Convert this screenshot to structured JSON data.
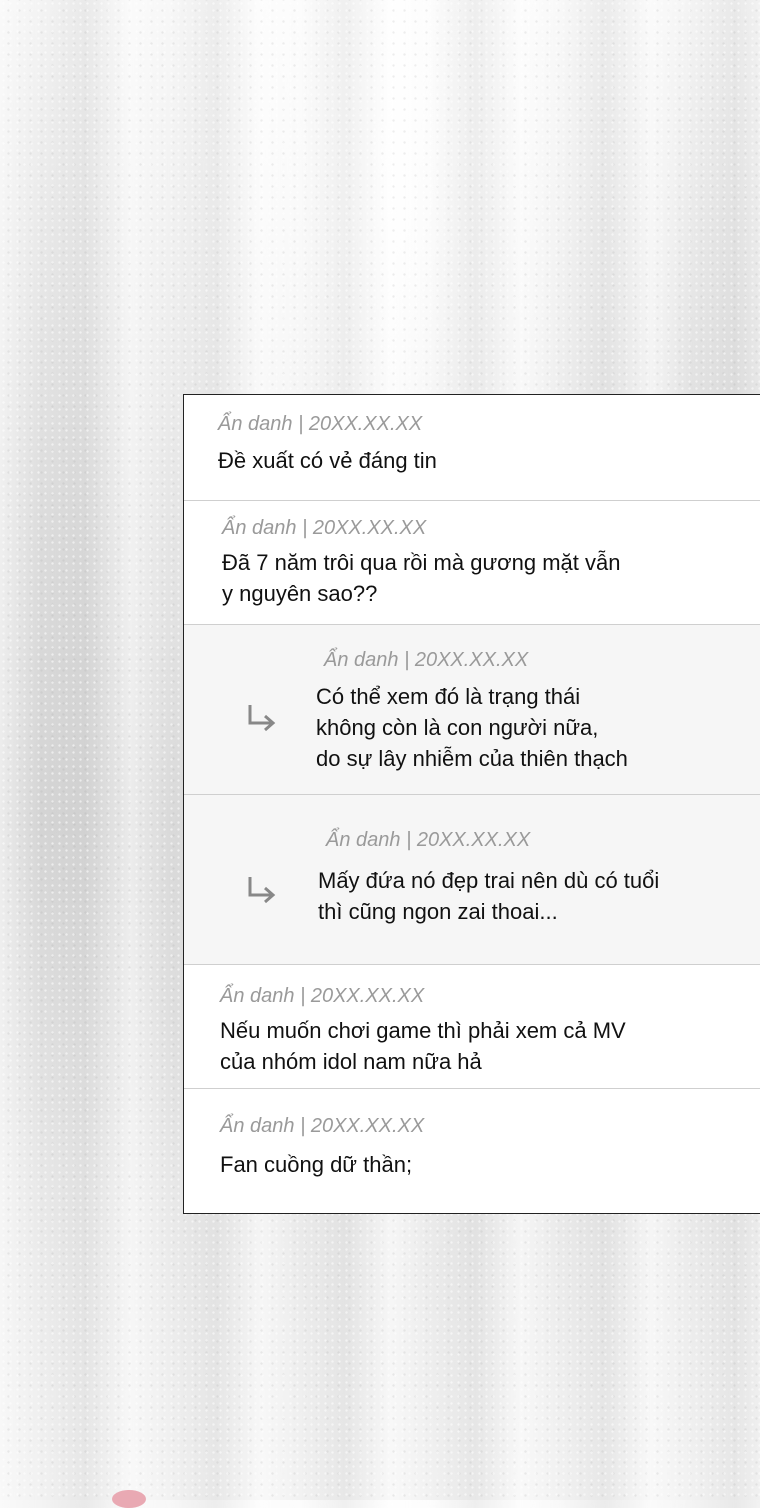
{
  "comments": [
    {
      "meta": "Ẩn danh | 20XX.XX.XX",
      "text": "Đề xuất có vẻ đáng tin",
      "reply": false
    },
    {
      "meta": "Ẩn danh | 20XX.XX.XX",
      "text": "Đã 7 năm trôi qua rồi mà gương mặt vẫn\ny nguyên sao??",
      "reply": false
    },
    {
      "meta": "Ẩn danh | 20XX.XX.XX",
      "text": "Có thể xem đó là trạng thái\nkhông còn là con người nữa,\ndo sự lây nhiễm của thiên thạch",
      "reply": true
    },
    {
      "meta": "Ẩn danh | 20XX.XX.XX",
      "text": "Mấy đứa nó đẹp trai nên dù có tuổi\nthì cũng ngon zai thoai...",
      "reply": true
    },
    {
      "meta": "Ẩn danh | 20XX.XX.XX",
      "text": "Nếu muốn chơi game thì phải xem cả MV\ncủa nhóm idol nam nữa hả",
      "reply": false
    },
    {
      "meta": "Ẩn danh | 20XX.XX.XX",
      "text": "Fan cuồng dữ thần;",
      "reply": false
    }
  ],
  "colors": {
    "meta": "#9a9a9a",
    "text": "#111111",
    "reply_bg": "#f6f6f6",
    "divider": "#cfcfcf"
  },
  "icons": {
    "reply": "reply-arrow-icon"
  }
}
